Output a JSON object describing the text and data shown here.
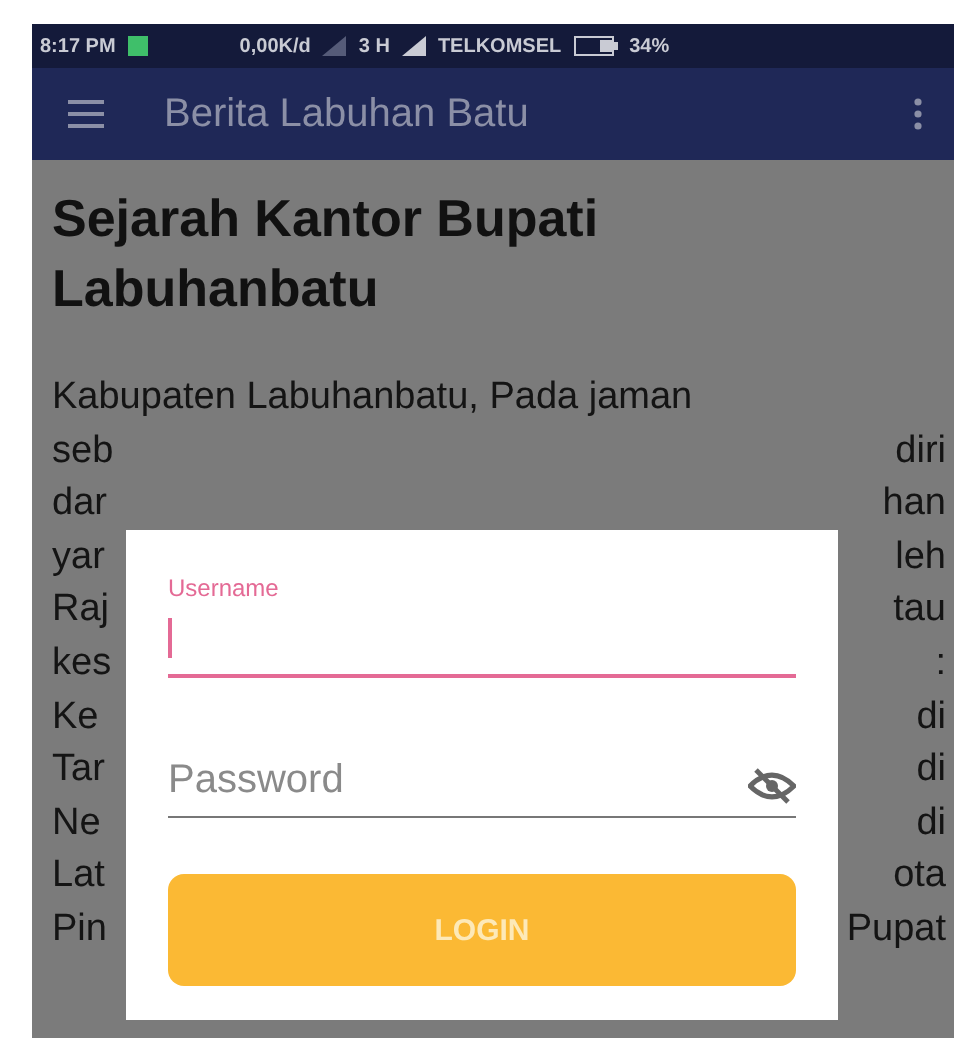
{
  "status_bar": {
    "time": "8:17 PM",
    "speed": "0,00K/d",
    "network": "3 H",
    "carrier": "TELKOMSEL",
    "battery": "34%"
  },
  "app_bar": {
    "title": "Berita Labuhan Batu"
  },
  "article": {
    "title": "Sejarah Kantor Bupati Labuhanbatu",
    "first_line": "Kabupaten Labuhanbatu, Pada jaman",
    "lines": [
      {
        "left": "seb",
        "right": "diri"
      },
      {
        "left": "dar",
        "right": "han"
      },
      {
        "left": "yar",
        "right": "leh"
      },
      {
        "left": "Raj",
        "right": "tau"
      },
      {
        "left": "kes",
        "right": ":"
      },
      {
        "left": "Ke",
        "right": "di"
      },
      {
        "left": "Tar",
        "right": "di"
      },
      {
        "left": "Ne",
        "right": "di"
      },
      {
        "left": "Lat",
        "right": "ota"
      },
      {
        "left": "Pin",
        "right": "Pupat"
      }
    ]
  },
  "dialog": {
    "fields": [
      {
        "kind": "text",
        "label": "Username",
        "focused": true
      },
      {
        "kind": "password",
        "placeholder": "Password",
        "focused": false
      }
    ],
    "button": "LOGIN"
  }
}
